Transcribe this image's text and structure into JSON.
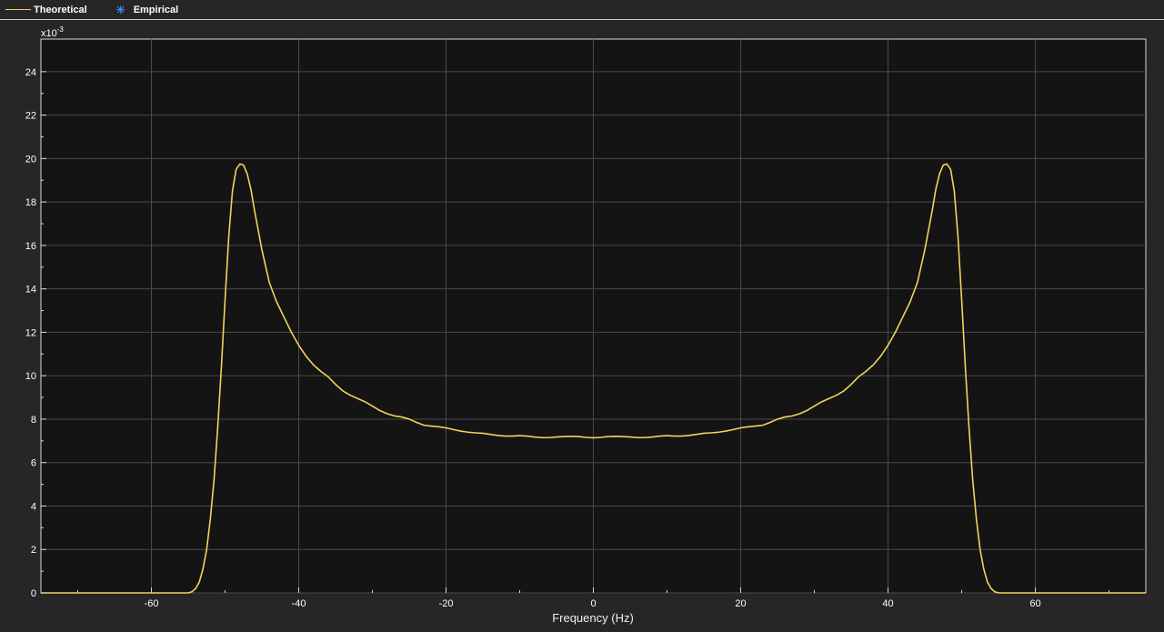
{
  "legend": {
    "items": [
      {
        "label": "Theoretical",
        "color": "#f2d35b",
        "marker": "line"
      },
      {
        "label": "Empirical",
        "color": "#2f8ef5",
        "marker": "star"
      }
    ]
  },
  "chart_data": {
    "type": "line",
    "xlabel": "Frequency (Hz)",
    "ylabel": "",
    "y_exponent_label": "x10",
    "y_exponent_power": "-3",
    "xlim": [
      -75,
      75
    ],
    "ylim": [
      0,
      25.5
    ],
    "x_ticks": [
      -60,
      -40,
      -20,
      0,
      20,
      40,
      60
    ],
    "y_ticks": [
      0,
      2,
      4,
      6,
      8,
      10,
      12,
      14,
      16,
      18,
      20,
      22,
      24
    ],
    "grid": true,
    "legend_position": "top-left",
    "background": "#141414",
    "series": [
      {
        "name": "Theoretical",
        "color": "#f2d35b",
        "x": [
          -75,
          -55,
          -54.5,
          -54,
          -53.5,
          -53,
          -52.5,
          -52,
          -51.5,
          -51,
          -50.5,
          -50,
          -49.5,
          -49,
          -48.5,
          -48,
          -47.5,
          -47,
          -46.5,
          -46,
          -45.5,
          -45,
          -44,
          -43,
          -42,
          -41,
          -40,
          -39,
          -38,
          -37,
          -36,
          -35,
          -34,
          -33,
          -32,
          -31,
          -30,
          -29,
          -28,
          -27,
          -26,
          -25,
          -24,
          -23,
          -22,
          -21,
          -20,
          -19,
          -18,
          -17,
          -16,
          -15,
          -14,
          -13,
          -12,
          -11,
          -10,
          -9,
          -8,
          -7,
          -6,
          -5,
          -4,
          -3,
          -2,
          -1,
          0,
          1,
          2,
          3,
          4,
          5,
          6,
          7,
          8,
          9,
          10,
          11,
          12,
          13,
          14,
          15,
          16,
          17,
          18,
          19,
          20,
          21,
          22,
          23,
          24,
          25,
          26,
          27,
          28,
          29,
          30,
          31,
          32,
          33,
          34,
          35,
          36,
          37,
          38,
          39,
          40,
          41,
          42,
          43,
          44,
          45,
          45.5,
          46,
          46.5,
          47,
          47.5,
          48,
          48.5,
          49,
          49.5,
          50,
          50.5,
          51,
          51.5,
          52,
          52.5,
          53,
          53.5,
          54,
          54.5,
          55,
          75
        ],
        "y": [
          0,
          0,
          0.05,
          0.2,
          0.5,
          1.1,
          2.0,
          3.4,
          5.2,
          7.6,
          10.4,
          13.5,
          16.4,
          18.5,
          19.5,
          19.75,
          19.7,
          19.3,
          18.6,
          17.6,
          16.7,
          15.8,
          14.3,
          13.4,
          12.7,
          12.0,
          11.4,
          10.9,
          10.5,
          10.2,
          9.95,
          9.6,
          9.3,
          9.1,
          8.95,
          8.8,
          8.6,
          8.4,
          8.25,
          8.15,
          8.1,
          8.0,
          7.85,
          7.72,
          7.68,
          7.65,
          7.6,
          7.52,
          7.45,
          7.4,
          7.37,
          7.35,
          7.3,
          7.25,
          7.22,
          7.22,
          7.24,
          7.22,
          7.18,
          7.15,
          7.15,
          7.18,
          7.2,
          7.21,
          7.2,
          7.16,
          7.14,
          7.16,
          7.2,
          7.21,
          7.2,
          7.18,
          7.15,
          7.15,
          7.18,
          7.22,
          7.24,
          7.22,
          7.22,
          7.25,
          7.3,
          7.35,
          7.37,
          7.4,
          7.45,
          7.52,
          7.6,
          7.65,
          7.68,
          7.72,
          7.85,
          8.0,
          8.1,
          8.15,
          8.25,
          8.4,
          8.6,
          8.8,
          8.95,
          9.1,
          9.3,
          9.6,
          9.95,
          10.2,
          10.5,
          10.9,
          11.4,
          12.0,
          12.7,
          13.4,
          14.3,
          15.8,
          16.7,
          17.6,
          18.6,
          19.3,
          19.7,
          19.75,
          19.5,
          18.5,
          16.4,
          13.5,
          10.4,
          7.6,
          5.2,
          3.4,
          2.0,
          1.1,
          0.5,
          0.2,
          0.05,
          0,
          0
        ]
      }
    ]
  }
}
